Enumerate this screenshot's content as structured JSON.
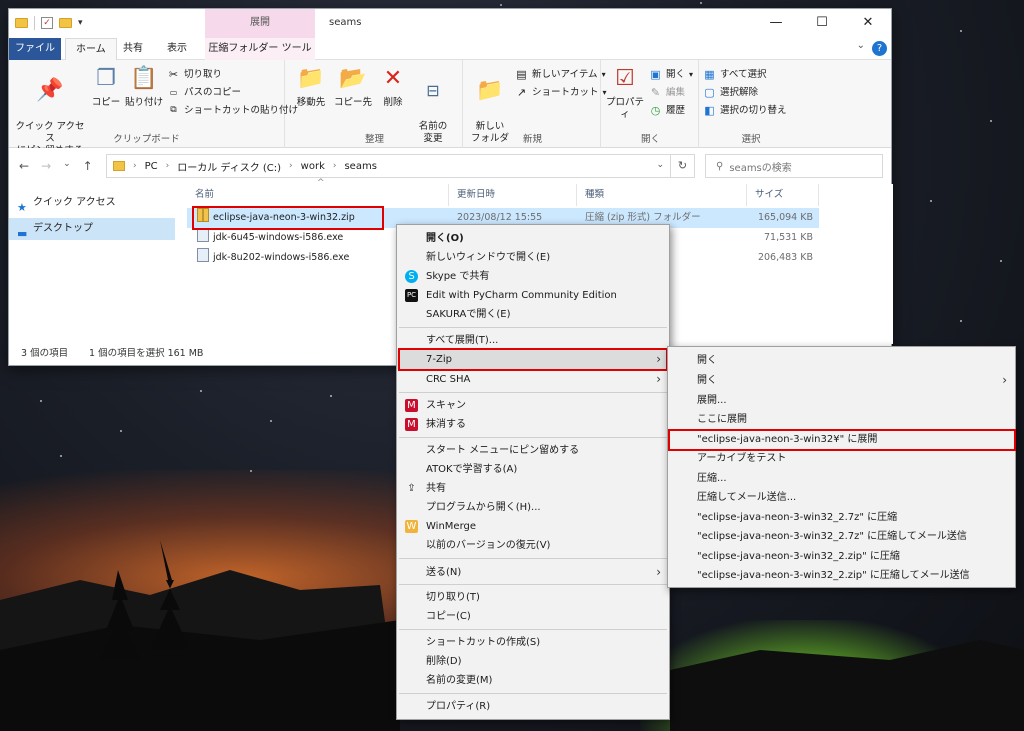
{
  "window": {
    "title": "seams",
    "context_tab_header": "展開",
    "controls": {
      "minimize": "—",
      "maximize": "☐",
      "close": "✕"
    },
    "help": "?"
  },
  "ribbon_tabs": [
    "ファイル",
    "ホーム",
    "共有",
    "表示",
    "圧縮フォルダー ツール"
  ],
  "ribbon": {
    "clipboard": {
      "label": "クリップボード",
      "pin": "クイック アクセス\nにピン留めする",
      "copy": "コピー",
      "paste": "貼り付け",
      "cut": "切り取り",
      "copy_path": "パスのコピー",
      "paste_shortcut": "ショートカットの貼り付け"
    },
    "organize": {
      "label": "整理",
      "move_to": "移動先",
      "copy_to": "コピー先",
      "delete": "削除",
      "rename": "名前の\n変更"
    },
    "new": {
      "label": "新規",
      "new_folder": "新しい\nフォルダー",
      "new_item": "新しいアイテム",
      "shortcut": "ショートカット"
    },
    "open": {
      "label": "開く",
      "properties": "プロパティ",
      "open": "開く",
      "edit": "編集",
      "history": "履歴"
    },
    "select": {
      "label": "選択",
      "select_all": "すべて選択",
      "select_none": "選択解除",
      "invert": "選択の切り替え"
    }
  },
  "address": {
    "crumbs": [
      "PC",
      "ローカル ディスク (C:)",
      "work",
      "seams"
    ],
    "search_placeholder": "seamsの検索"
  },
  "nav_pane": {
    "items": [
      "クイック アクセス",
      "デスクトップ"
    ]
  },
  "columns": [
    "名前",
    "更新日時",
    "種類",
    "サイズ"
  ],
  "files": [
    {
      "name": "eclipse-java-neon-3-win32.zip",
      "date": "2023/08/12 15:55",
      "type": "圧縮 (zip 形式) フォルダー",
      "size": "165,094 KB"
    },
    {
      "name": "jdk-6u45-windows-i586.exe",
      "date": "",
      "type": "",
      "size": "71,531 KB"
    },
    {
      "name": "jdk-8u202-windows-i586.exe",
      "date": "",
      "type": "",
      "size": "206,483 KB"
    }
  ],
  "status": {
    "count": "3 個の項目",
    "selected": "1 個の項目を選択  161 MB"
  },
  "context_menu": [
    "開く(O)",
    "新しいウィンドウで開く(E)",
    "Skype で共有",
    "Edit with PyCharm Community Edition",
    "SAKURAで開く(E)",
    "すべて展開(T)...",
    "7-Zip",
    "CRC SHA",
    "スキャン",
    "抹消する",
    "スタート メニューにピン留めする",
    "ATOKで学習する(A)",
    "共有",
    "プログラムから開く(H)...",
    "WinMerge",
    "以前のバージョンの復元(V)",
    "送る(N)",
    "切り取り(T)",
    "コピー(C)",
    "ショートカットの作成(S)",
    "削除(D)",
    "名前の変更(M)",
    "プロパティ(R)"
  ],
  "submenu_7zip": [
    "開く",
    "開く",
    "展開...",
    "ここに展開",
    "\"eclipse-java-neon-3-win32¥\" に展開",
    "アーカイブをテスト",
    "圧縮...",
    "圧縮してメール送信...",
    "\"eclipse-java-neon-3-win32_2.7z\" に圧縮",
    "\"eclipse-java-neon-3-win32_2.7z\" に圧縮してメール送信",
    "\"eclipse-java-neon-3-win32_2.zip\" に圧縮",
    "\"eclipse-java-neon-3-win32_2.zip\" に圧縮してメール送信"
  ],
  "colors": {
    "file_tab": "#2b579a",
    "highlight_box": "#e00000",
    "selection": "#cce8ff"
  }
}
